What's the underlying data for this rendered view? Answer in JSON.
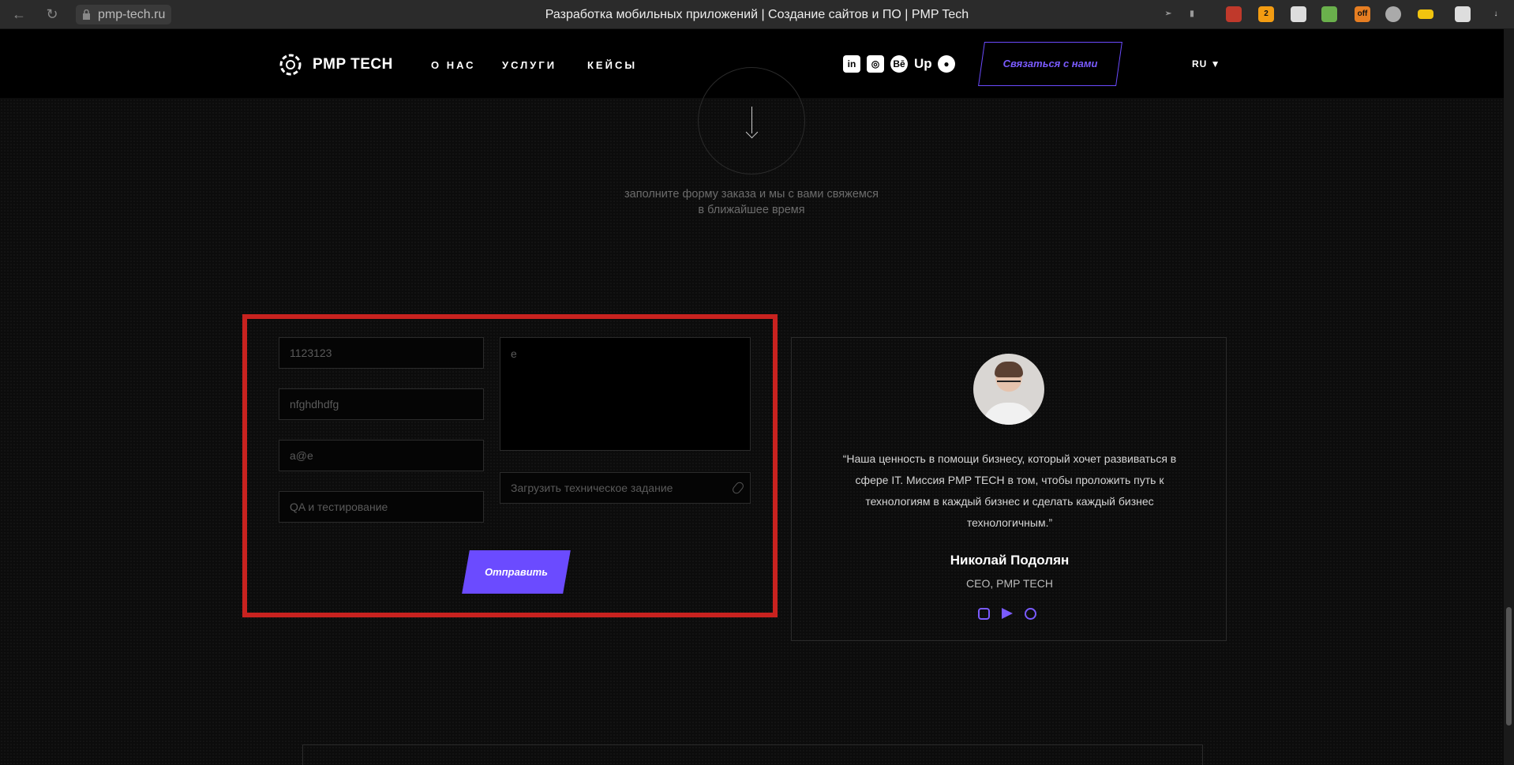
{
  "browser": {
    "url": "pmp-tech.ru",
    "title": "Разработка мобильных приложений | Создание сайтов и ПО | PMP Tech"
  },
  "header": {
    "logo_text": "PMP TECH",
    "nav": [
      "О НАС",
      "УСЛУГИ",
      "КЕЙСЫ"
    ],
    "socials": [
      "linkedin-icon",
      "instagram-icon",
      "behance-icon",
      "upwork-icon",
      "github-icon"
    ],
    "contact_button": "Связаться с нами",
    "lang": "RU"
  },
  "intro": {
    "text": "заполните форму заказа и мы с вами свяжемся в ближайшее время"
  },
  "form": {
    "field_1": "1123123",
    "field_2": "nfghdhdfg",
    "field_3": "a@e",
    "field_4": "QA и тестирование",
    "message": "e",
    "upload_placeholder": "Загрузить техническое задание",
    "submit": "Отправить"
  },
  "ceo": {
    "quote": "“Наша ценность в помощи бизнесу, который хочет развиваться в сфере IT. Миссия PMP TECH в том, чтобы проложить путь к технологиям в каждый бизнес и сделать каждый бизнес технологичным.”",
    "name": "Николай Подолян",
    "role": "CEO, PMP TECH"
  },
  "colors": {
    "accent": "#6b4bff",
    "highlight": "#c8221f"
  }
}
